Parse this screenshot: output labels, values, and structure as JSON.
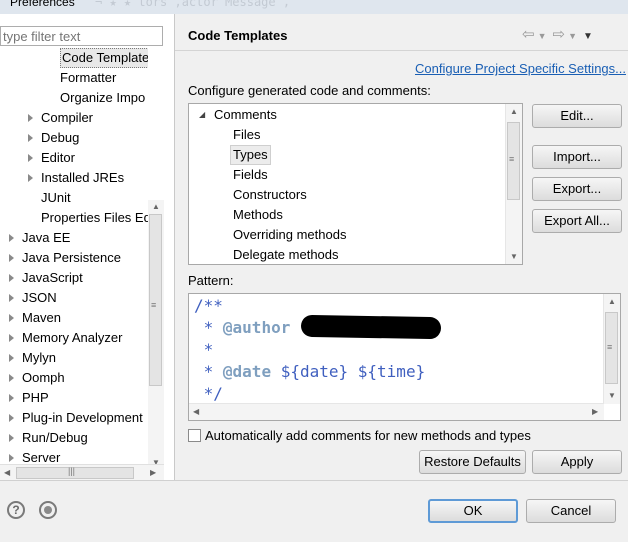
{
  "window": {
    "title": "Preferences",
    "ghost_text": "¬ ★ ★ tors ,actor Message ,"
  },
  "sidebar": {
    "filter_placeholder": "type filter text",
    "items": [
      {
        "label": "Code Template",
        "indent": 60,
        "expandable": false,
        "selected": true
      },
      {
        "label": "Formatter",
        "indent": 60,
        "expandable": false
      },
      {
        "label": "Organize Impo",
        "indent": 60,
        "expandable": false
      },
      {
        "label": "Compiler",
        "indent": 41,
        "expandable": true
      },
      {
        "label": "Debug",
        "indent": 41,
        "expandable": true
      },
      {
        "label": "Editor",
        "indent": 41,
        "expandable": true
      },
      {
        "label": "Installed JREs",
        "indent": 41,
        "expandable": true
      },
      {
        "label": "JUnit",
        "indent": 41,
        "expandable": false
      },
      {
        "label": "Properties Files Ed",
        "indent": 41,
        "expandable": false
      },
      {
        "label": "Java EE",
        "indent": 22,
        "expandable": true
      },
      {
        "label": "Java Persistence",
        "indent": 22,
        "expandable": true
      },
      {
        "label": "JavaScript",
        "indent": 22,
        "expandable": true
      },
      {
        "label": "JSON",
        "indent": 22,
        "expandable": true
      },
      {
        "label": "Maven",
        "indent": 22,
        "expandable": true
      },
      {
        "label": "Memory Analyzer",
        "indent": 22,
        "expandable": true
      },
      {
        "label": "Mylyn",
        "indent": 22,
        "expandable": true
      },
      {
        "label": "Oomph",
        "indent": 22,
        "expandable": true
      },
      {
        "label": "PHP",
        "indent": 22,
        "expandable": true
      },
      {
        "label": "Plug-in Development",
        "indent": 22,
        "expandable": true
      },
      {
        "label": "Run/Debug",
        "indent": 22,
        "expandable": true
      },
      {
        "label": "Server",
        "indent": 22,
        "expandable": true
      }
    ]
  },
  "main": {
    "title": "Code Templates",
    "project_link": "Configure Project Specific Settings...",
    "configure_label": "Configure generated code and comments:",
    "templates": [
      {
        "label": "Comments",
        "expanded": true,
        "level": 0
      },
      {
        "label": "Files",
        "level": 1
      },
      {
        "label": "Types",
        "level": 1,
        "selected": true
      },
      {
        "label": "Fields",
        "level": 1
      },
      {
        "label": "Constructors",
        "level": 1
      },
      {
        "label": "Methods",
        "level": 1
      },
      {
        "label": "Overriding methods",
        "level": 1
      },
      {
        "label": "Delegate methods",
        "level": 1
      }
    ],
    "buttons": {
      "edit": "Edit...",
      "import": "Import...",
      "export": "Export...",
      "export_all": "Export All..."
    },
    "pattern_label": "Pattern:",
    "pattern_lines": [
      {
        "text": "/**"
      },
      {
        "text": " * ",
        "tag": "@author"
      },
      {
        "text": " *"
      },
      {
        "text": " * ",
        "tag": "@date",
        "rest": " ${date} ${time}"
      },
      {
        "text": " */"
      }
    ],
    "auto_comments_label": "Automatically add comments for new methods and types",
    "auto_comments_checked": false,
    "restore_defaults": "Restore Defaults",
    "apply": "Apply"
  },
  "footer": {
    "ok": "OK",
    "cancel": "Cancel"
  },
  "colors": {
    "link": "#1a5fb4",
    "comment": "#3f5fbf",
    "javadoc_tag": "#7f9fbf",
    "selection": "#e8e8e8"
  }
}
